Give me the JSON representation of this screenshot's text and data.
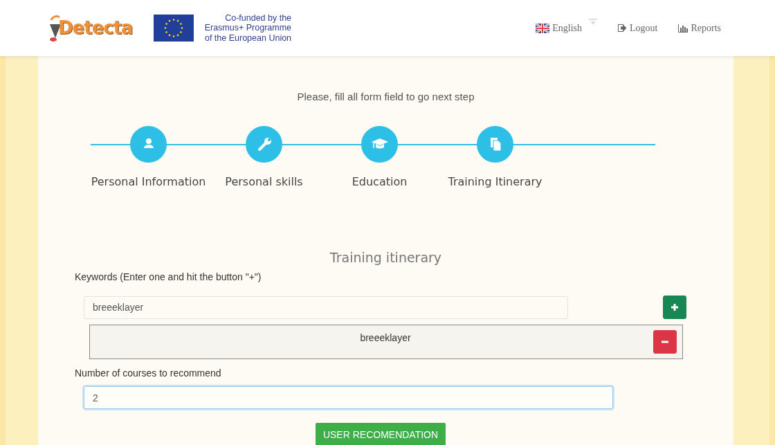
{
  "header": {
    "logo": "Detecta",
    "eu_text": [
      "Co-funded by the",
      "Erasmus+ Programme",
      "of the European Union"
    ],
    "nav": [
      {
        "kind": "language",
        "label": "English"
      },
      {
        "kind": "logout",
        "label": "Logout"
      },
      {
        "kind": "reports",
        "label": "Reports"
      }
    ]
  },
  "form": {
    "intro": "Please, fill all form field to go next step",
    "steps": [
      {
        "kind": "person",
        "label": "Personal Information"
      },
      {
        "kind": "wrench",
        "label": "Personal skills"
      },
      {
        "kind": "cap",
        "label": "Education"
      },
      {
        "kind": "document",
        "label": "Training Itinerary"
      }
    ],
    "section_title": "Training itinerary",
    "keywords_label": "Keywords (Enter one and hit the button \"+\")",
    "keyword_input": "breeeklayer",
    "keywords": [
      "breeeklayer"
    ],
    "courses_label": "Number of courses to recommend",
    "courses_value": "2",
    "submit": "USER RECOMENDATION"
  }
}
